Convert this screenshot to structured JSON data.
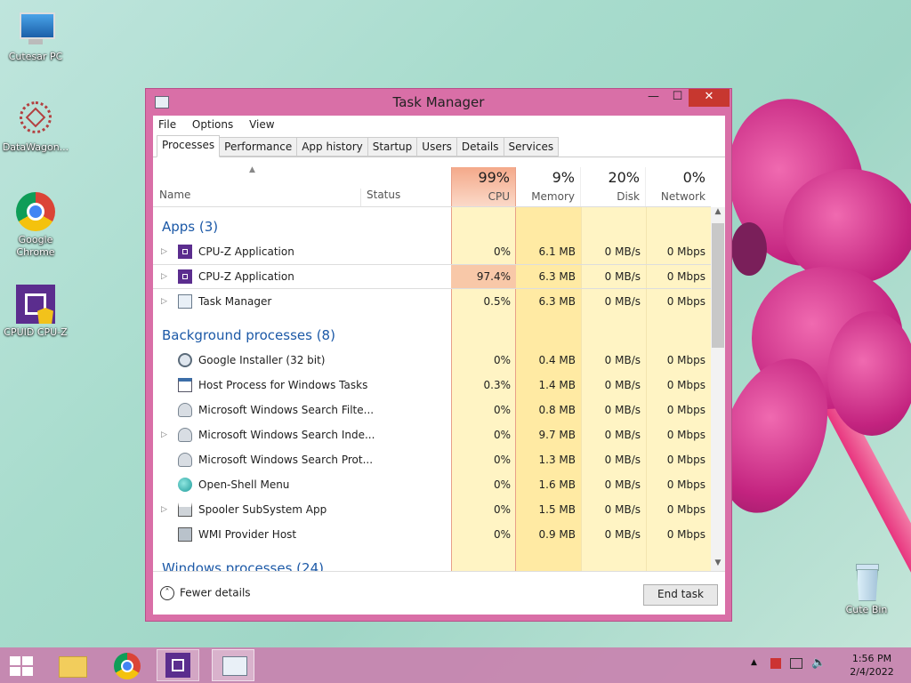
{
  "desktop": {
    "icons": [
      {
        "label": "Cutesar PC",
        "icon": "computer-icon"
      },
      {
        "label": "DataWagon...",
        "icon": "datawagon-icon"
      },
      {
        "label": "Google Chrome",
        "icon": "chrome-icon"
      },
      {
        "label": "CPUID CPU-Z",
        "icon": "cpuz-icon"
      },
      {
        "label": "Cute Bin",
        "icon": "recycle-bin-icon"
      }
    ]
  },
  "window": {
    "title": "Task Manager",
    "controls": {
      "minimize": "—",
      "maximize": "☐",
      "close": "✕"
    }
  },
  "menu": [
    "File",
    "Options",
    "View"
  ],
  "tabs": [
    "Processes",
    "Performance",
    "App history",
    "Startup",
    "Users",
    "Details",
    "Services"
  ],
  "columns": {
    "name": "Name",
    "status": "Status",
    "cpu": {
      "pct": "99%",
      "label": "CPU"
    },
    "memory": {
      "pct": "9%",
      "label": "Memory"
    },
    "disk": {
      "pct": "20%",
      "label": "Disk"
    },
    "network": {
      "pct": "0%",
      "label": "Network"
    }
  },
  "groups": {
    "apps": "Apps (3)",
    "background": "Background processes (8)",
    "windows": "Windows processes (24)"
  },
  "processes": [
    {
      "name": "CPU-Z Application",
      "icon": "cpuz-icon",
      "cpu": "0%",
      "memory": "6.1 MB",
      "disk": "0 MB/s",
      "network": "0 Mbps"
    },
    {
      "name": "CPU-Z Application",
      "icon": "cpuz-icon",
      "cpu": "97.4%",
      "memory": "6.3 MB",
      "disk": "0 MB/s",
      "network": "0 Mbps"
    },
    {
      "name": "Task Manager",
      "icon": "task-manager-icon",
      "cpu": "0.5%",
      "memory": "6.3 MB",
      "disk": "0 MB/s",
      "network": "0 Mbps"
    },
    {
      "name": "Google Installer (32 bit)",
      "icon": "installer-icon",
      "cpu": "0%",
      "memory": "0.4 MB",
      "disk": "0 MB/s",
      "network": "0 Mbps"
    },
    {
      "name": "Host Process for Windows Tasks",
      "icon": "window-process-icon",
      "cpu": "0.3%",
      "memory": "1.4 MB",
      "disk": "0 MB/s",
      "network": "0 Mbps"
    },
    {
      "name": "Microsoft Windows Search Filte...",
      "icon": "search-user-icon",
      "cpu": "0%",
      "memory": "0.8 MB",
      "disk": "0 MB/s",
      "network": "0 Mbps"
    },
    {
      "name": "Microsoft Windows Search Inde...",
      "icon": "search-user-icon",
      "cpu": "0%",
      "memory": "9.7 MB",
      "disk": "0 MB/s",
      "network": "0 Mbps"
    },
    {
      "name": "Microsoft Windows Search Prot...",
      "icon": "search-user-icon",
      "cpu": "0%",
      "memory": "1.3 MB",
      "disk": "0 MB/s",
      "network": "0 Mbps"
    },
    {
      "name": "Open-Shell Menu",
      "icon": "open-shell-icon",
      "cpu": "0%",
      "memory": "1.6 MB",
      "disk": "0 MB/s",
      "network": "0 Mbps"
    },
    {
      "name": "Spooler SubSystem App",
      "icon": "printer-icon",
      "cpu": "0%",
      "memory": "1.5 MB",
      "disk": "0 MB/s",
      "network": "0 Mbps"
    },
    {
      "name": "WMI Provider Host",
      "icon": "wmi-icon",
      "cpu": "0%",
      "memory": "0.9 MB",
      "disk": "0 MB/s",
      "network": "0 Mbps"
    }
  ],
  "footer": {
    "fewer_details": "Fewer details",
    "end_task": "End task"
  },
  "taskbar": {
    "time": "1:56 PM",
    "date": "2/4/2022"
  },
  "colors": {
    "accent": "#d96fa7",
    "group_text": "#1c59a7",
    "cpu_hot": "#f8c8a8",
    "heat_light": "#fff4c4",
    "heat_mid": "#ffeaa3"
  }
}
